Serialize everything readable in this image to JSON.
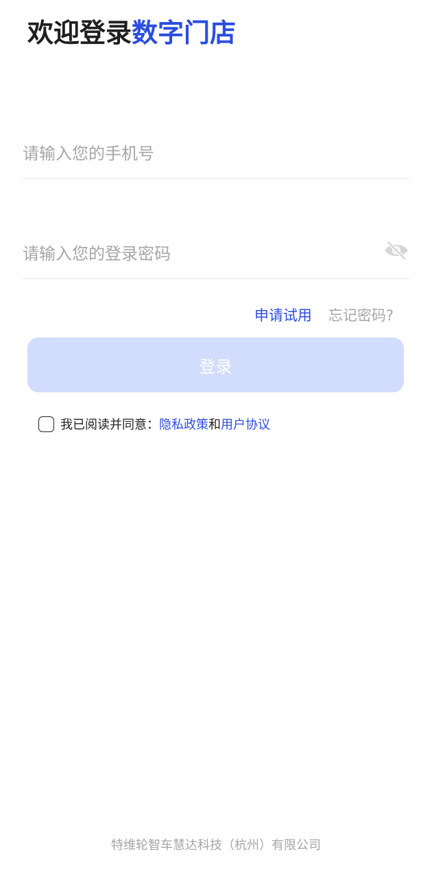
{
  "header": {
    "title_prefix": "欢迎登录",
    "title_highlight": "数字门店"
  },
  "form": {
    "phone_placeholder": "请输入您的手机号",
    "password_placeholder": "请输入您的登录密码",
    "password_toggle_icon": "eye-off-icon"
  },
  "links": {
    "apply_trial": "申请试用",
    "forgot_password": "忘记密码?"
  },
  "login_button": {
    "label": "登录"
  },
  "agreement": {
    "prefix": "我已阅读并同意：",
    "privacy_policy": "隐私政策",
    "conjunction": "和",
    "user_agreement": "用户协议",
    "checked": false
  },
  "footer": {
    "company": "特维轮智车慧达科技（杭州）有限公司"
  },
  "colors": {
    "accent": "#2b4de0",
    "button_bg": "#d2dcfc",
    "placeholder": "#a6a6a6",
    "divider": "#e6e6e6"
  }
}
